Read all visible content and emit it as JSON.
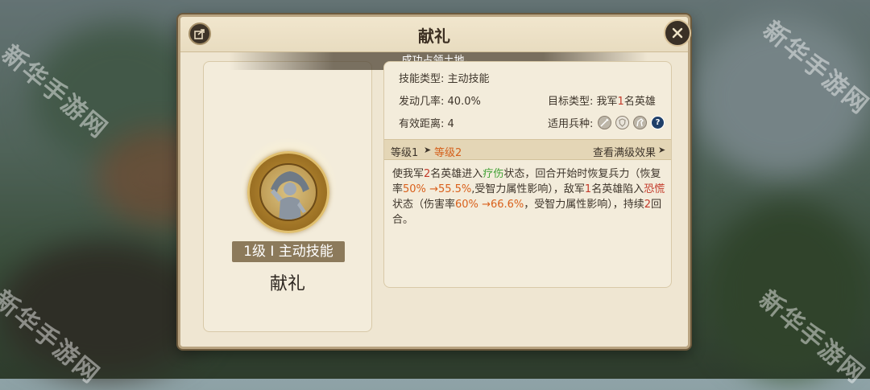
{
  "dialog": {
    "title": "献礼"
  },
  "notification": {
    "prefix": "",
    "part1": "成功占领",
    "highlight": "",
    "part2": "土地。"
  },
  "skill": {
    "level_badge": "1级 I 主动技能",
    "name": "献礼",
    "icon": "statue-figure-icon"
  },
  "info": {
    "skill_type_label": "技能类型:",
    "skill_type_value": "主动技能",
    "trigger_rate_label": "发动几率:",
    "trigger_rate_value": "40.0%",
    "target_type_label": "目标类型:",
    "target_type_prefix": "我军",
    "target_type_count": "1",
    "target_type_suffix": "名英雄",
    "range_label": "有效距离:",
    "range_value": "4",
    "troops_label": "适用兵种:",
    "troops": [
      "sword-icon",
      "shield-icon",
      "horse-icon",
      "question-icon"
    ]
  },
  "levels": {
    "from": "等级1",
    "arrow": "➤",
    "to": "等级2",
    "view_max": "查看满级效果",
    "view_max_arrow": "➤"
  },
  "description": {
    "p1": "使我军",
    "n1": "2",
    "p2": "名英雄进入",
    "heal": "疗伤",
    "p3": "状态，回合开始时恢复兵力（恢复率",
    "v1a": "50%",
    "v1b": "→55.5%",
    "p4": ",受智力属性影响），敌军",
    "n2": "1",
    "p5": "名英雄陷入",
    "fear": "恐慌",
    "p6": "状态（伤害率",
    "v2a": "60%",
    "v2b": "→66.6%",
    "p7": "，受智力属性影响），持续",
    "n3": "2",
    "p8": "回合。"
  },
  "watermark": "新华手游网",
  "colors": {
    "accent_red": "#c33a2a",
    "accent_green": "#41a135",
    "accent_orange": "#d9601b",
    "gold": "#f0b042"
  }
}
